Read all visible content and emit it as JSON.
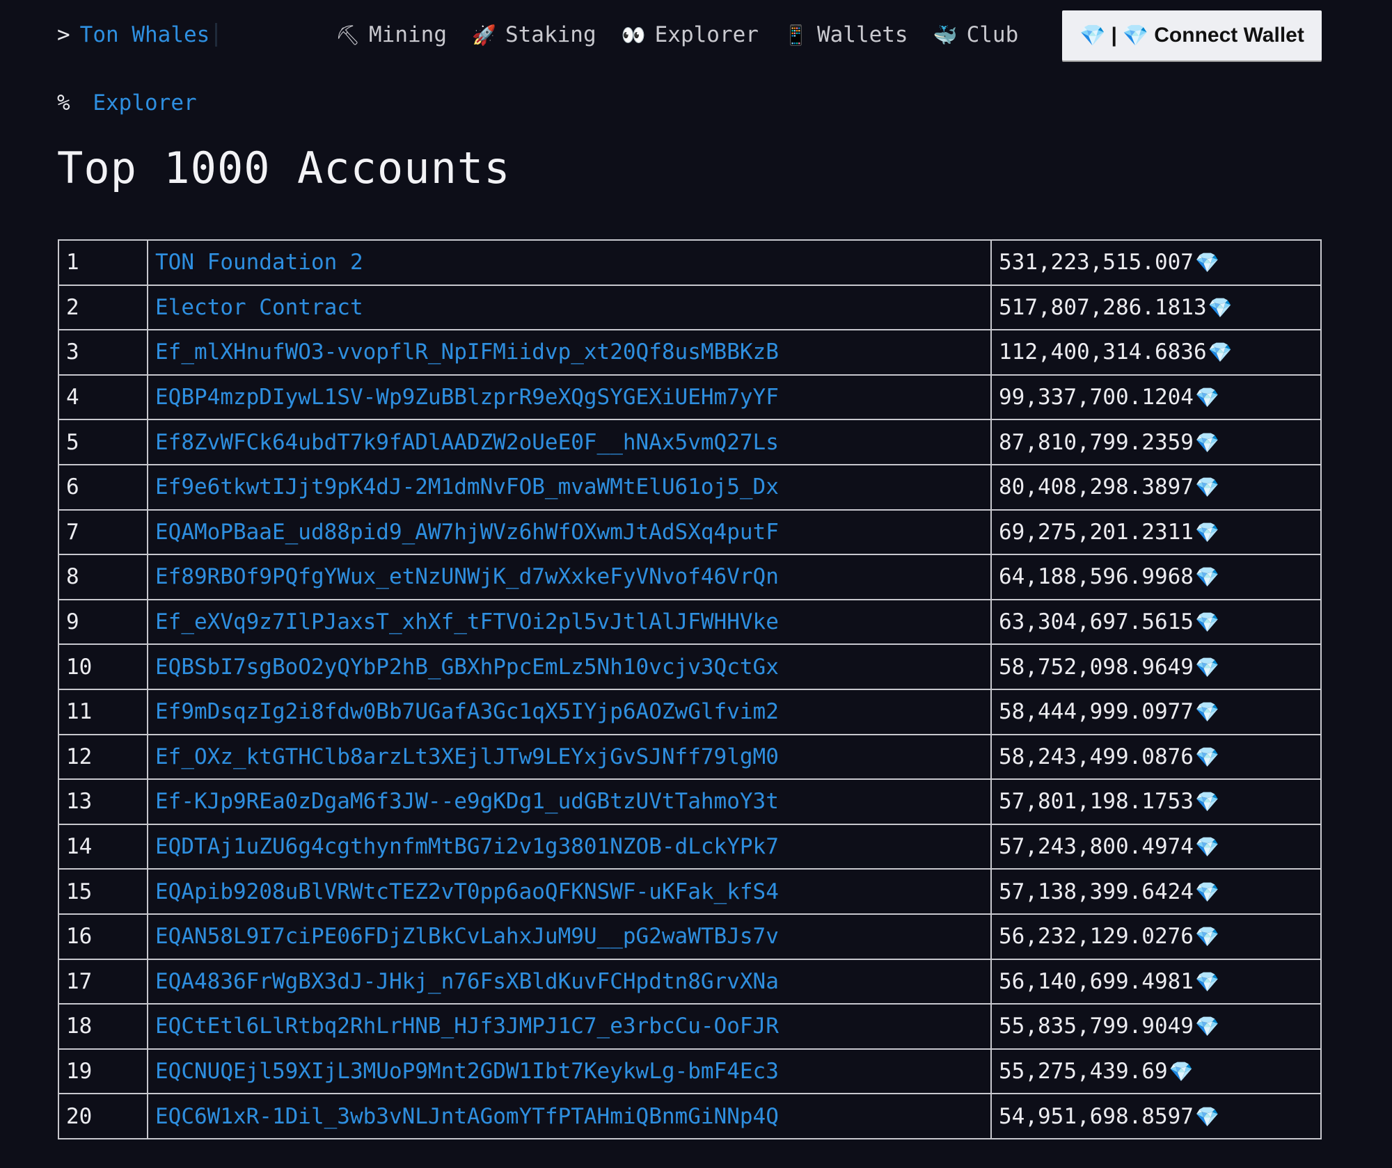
{
  "brand": {
    "prompt": ">",
    "name": "Ton Whales"
  },
  "nav": {
    "items": [
      {
        "icon": "pickaxe-icon",
        "glyph": "⛏",
        "label": "Mining"
      },
      {
        "icon": "rocket-icon",
        "glyph": "🚀",
        "label": "Staking"
      },
      {
        "icon": "eyes-icon",
        "glyph": "👀",
        "label": "Explorer"
      },
      {
        "icon": "phone-icon",
        "glyph": "📱",
        "label": "Wallets"
      },
      {
        "icon": "whale-icon",
        "glyph": "🐳",
        "label": "Club"
      }
    ],
    "connect_wallet": {
      "icon_left": "💎",
      "separator": "|",
      "icon_right": "💎",
      "label": "Connect Wallet"
    }
  },
  "breadcrumb": {
    "prefix": "%",
    "current": "Explorer"
  },
  "page": {
    "title": "Top 1000 Accounts"
  },
  "currency_icon": "💎",
  "accounts": [
    {
      "rank": "1",
      "name": "TON Foundation 2",
      "balance": "531,223,515.007"
    },
    {
      "rank": "2",
      "name": "Elector Contract",
      "balance": "517,807,286.1813"
    },
    {
      "rank": "3",
      "name": "Ef_mlXHnufWO3-vvopflR_NpIFMiidvp_xt20Qf8usMBBKzB",
      "balance": "112,400,314.6836"
    },
    {
      "rank": "4",
      "name": "EQBP4mzpDIywL1SV-Wp9ZuBBlzprR9eXQgSYGEXiUEHm7yYF",
      "balance": "99,337,700.1204"
    },
    {
      "rank": "5",
      "name": "Ef8ZvWFCk64ubdT7k9fADlAADZW2oUeE0F__hNAx5vmQ27Ls",
      "balance": "87,810,799.2359"
    },
    {
      "rank": "6",
      "name": "Ef9e6tkwtIJjt9pK4dJ-2M1dmNvFOB_mvaWMtElU61oj5_Dx",
      "balance": "80,408,298.3897"
    },
    {
      "rank": "7",
      "name": "EQAMoPBaaE_ud88pid9_AW7hjWVz6hWfOXwmJtAdSXq4putF",
      "balance": "69,275,201.2311"
    },
    {
      "rank": "8",
      "name": "Ef89RBOf9PQfgYWux_etNzUNWjK_d7wXxkeFyVNvof46VrQn",
      "balance": "64,188,596.9968"
    },
    {
      "rank": "9",
      "name": "Ef_eXVq9z7IlPJaxsT_xhXf_tFTVOi2pl5vJtlAlJFWHHVke",
      "balance": "63,304,697.5615"
    },
    {
      "rank": "10",
      "name": "EQBSbI7sgBoO2yQYbP2hB_GBXhPpcEmLz5Nh10vcjv3QctGx",
      "balance": "58,752,098.9649"
    },
    {
      "rank": "11",
      "name": "Ef9mDsqzIg2i8fdw0Bb7UGafA3Gc1qX5IYjp6AOZwGlfvim2",
      "balance": "58,444,999.0977"
    },
    {
      "rank": "12",
      "name": "Ef_OXz_ktGTHClb8arzLt3XEjlJTw9LEYxjGvSJNff79lgM0",
      "balance": "58,243,499.0876"
    },
    {
      "rank": "13",
      "name": "Ef-KJp9REa0zDgaM6f3JW--e9gKDg1_udGBtzUVtTahmoY3t",
      "balance": "57,801,198.1753"
    },
    {
      "rank": "14",
      "name": "EQDTAj1uZU6g4cgthynfmMtBG7i2v1g3801NZOB-dLckYPk7",
      "balance": "57,243,800.4974"
    },
    {
      "rank": "15",
      "name": "EQApib9208uBlVRWtcTEZ2vT0pp6aoQFKNSWF-uKFak_kfS4",
      "balance": "57,138,399.6424"
    },
    {
      "rank": "16",
      "name": "EQAN58L9I7ciPE06FDjZlBkCvLahxJuM9U__pG2waWTBJs7v",
      "balance": "56,232,129.0276"
    },
    {
      "rank": "17",
      "name": "EQA4836FrWgBX3dJ-JHkj_n76FsXBldKuvFCHpdtn8GrvXNa",
      "balance": "56,140,699.4981"
    },
    {
      "rank": "18",
      "name": "EQCtEtl6LlRtbq2RhLrHNB_HJf3JMPJ1C7_e3rbcCu-OoFJR",
      "balance": "55,835,799.9049"
    },
    {
      "rank": "19",
      "name": "EQCNUQEjl59XIjL3MUoP9Mnt2GDW1Ibt7KeykwLg-bmF4Ec3",
      "balance": "55,275,439.69"
    },
    {
      "rank": "20",
      "name": "EQC6W1xR-1Dil_3wb3vNLJntAGomYTfPTAHmiQBnmGiNNp4Q",
      "balance": "54,951,698.8597"
    }
  ]
}
